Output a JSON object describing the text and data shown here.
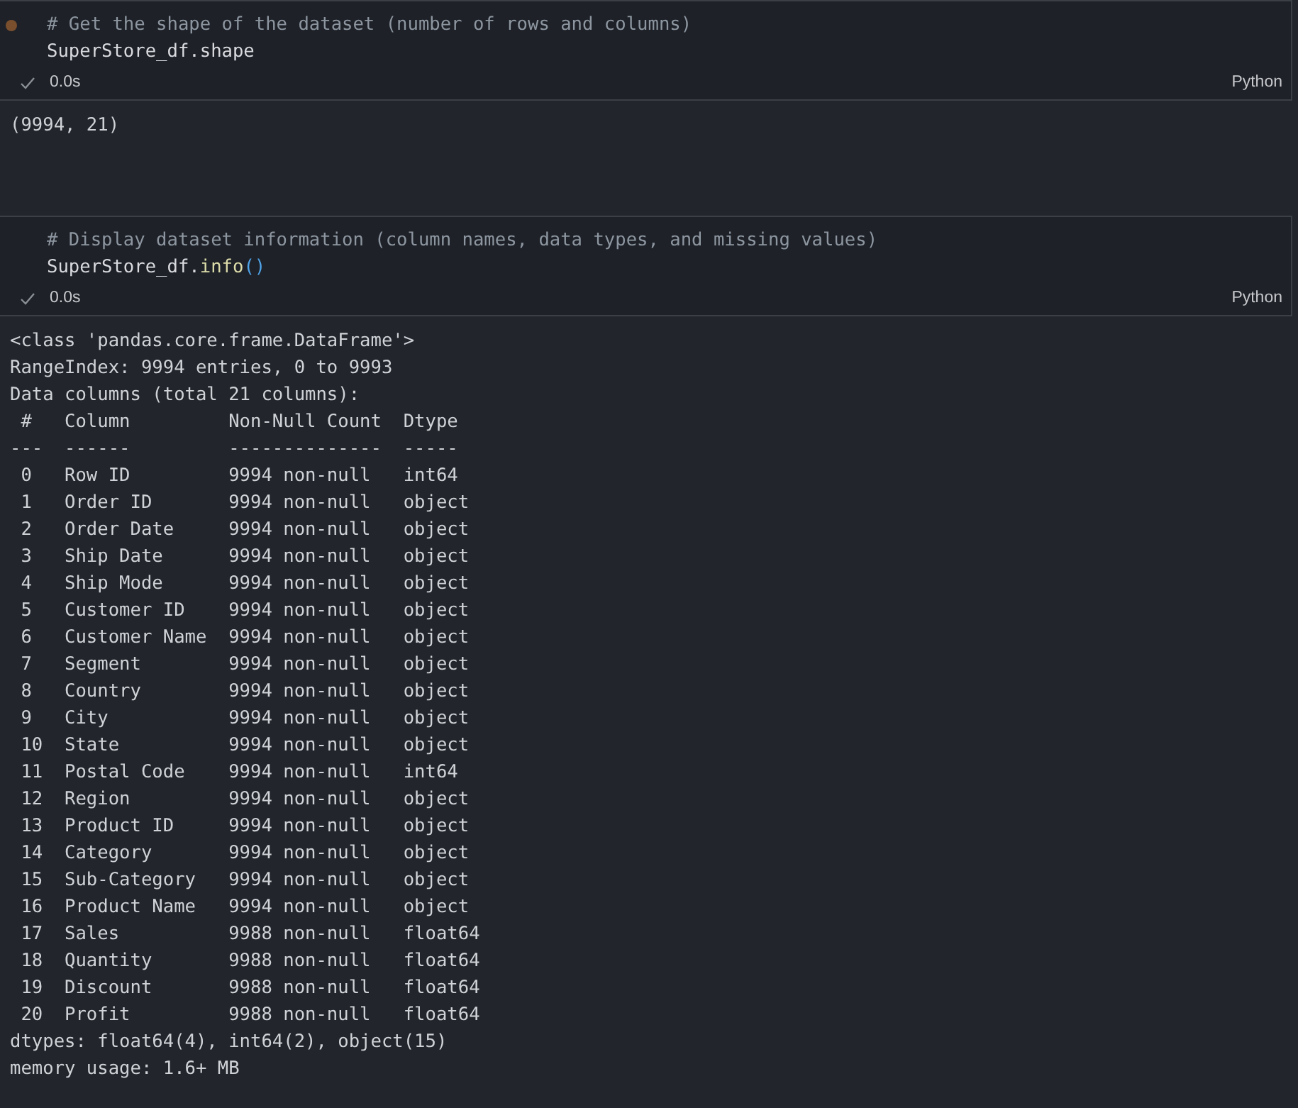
{
  "cells": [
    {
      "modified": true,
      "code_lines": [
        [
          {
            "kind": "comment",
            "text": "# Get the shape of the dataset (number of rows and columns)"
          }
        ],
        [
          {
            "kind": "plain",
            "text": "SuperStore_df.shape"
          }
        ]
      ],
      "status": {
        "success": true,
        "time": "0.0s",
        "language": "Python"
      },
      "output": [
        "(9994, 21)"
      ]
    },
    {
      "modified": false,
      "code_lines": [
        [
          {
            "kind": "comment",
            "text": "# Display dataset information (column names, data types, and missing values)"
          }
        ],
        [
          {
            "kind": "plain",
            "text": "SuperStore_df."
          },
          {
            "kind": "func",
            "text": "info"
          },
          {
            "kind": "paren",
            "text": "()"
          }
        ]
      ],
      "status": {
        "success": true,
        "time": "0.0s",
        "language": "Python"
      },
      "output": [
        "<class 'pandas.core.frame.DataFrame'>",
        "RangeIndex: 9994 entries, 0 to 9993",
        "Data columns (total 21 columns):",
        " #   Column         Non-Null Count  Dtype  ",
        "---  ------         --------------  -----  ",
        " 0   Row ID         9994 non-null   int64  ",
        " 1   Order ID       9994 non-null   object ",
        " 2   Order Date     9994 non-null   object ",
        " 3   Ship Date      9994 non-null   object ",
        " 4   Ship Mode      9994 non-null   object ",
        " 5   Customer ID    9994 non-null   object ",
        " 6   Customer Name  9994 non-null   object ",
        " 7   Segment        9994 non-null   object ",
        " 8   Country        9994 non-null   object ",
        " 9   City           9994 non-null   object ",
        " 10  State          9994 non-null   object ",
        " 11  Postal Code    9994 non-null   int64  ",
        " 12  Region         9994 non-null   object ",
        " 13  Product ID     9994 non-null   object ",
        " 14  Category       9994 non-null   object ",
        " 15  Sub-Category   9994 non-null   object ",
        " 16  Product Name   9994 non-null   object ",
        " 17  Sales          9988 non-null   float64",
        " 18  Quantity       9988 non-null   float64",
        " 19  Discount       9988 non-null   float64",
        " 20  Profit         9988 non-null   float64",
        "dtypes: float64(4), int64(2), object(15)",
        "memory usage: 1.6+ MB"
      ]
    }
  ]
}
